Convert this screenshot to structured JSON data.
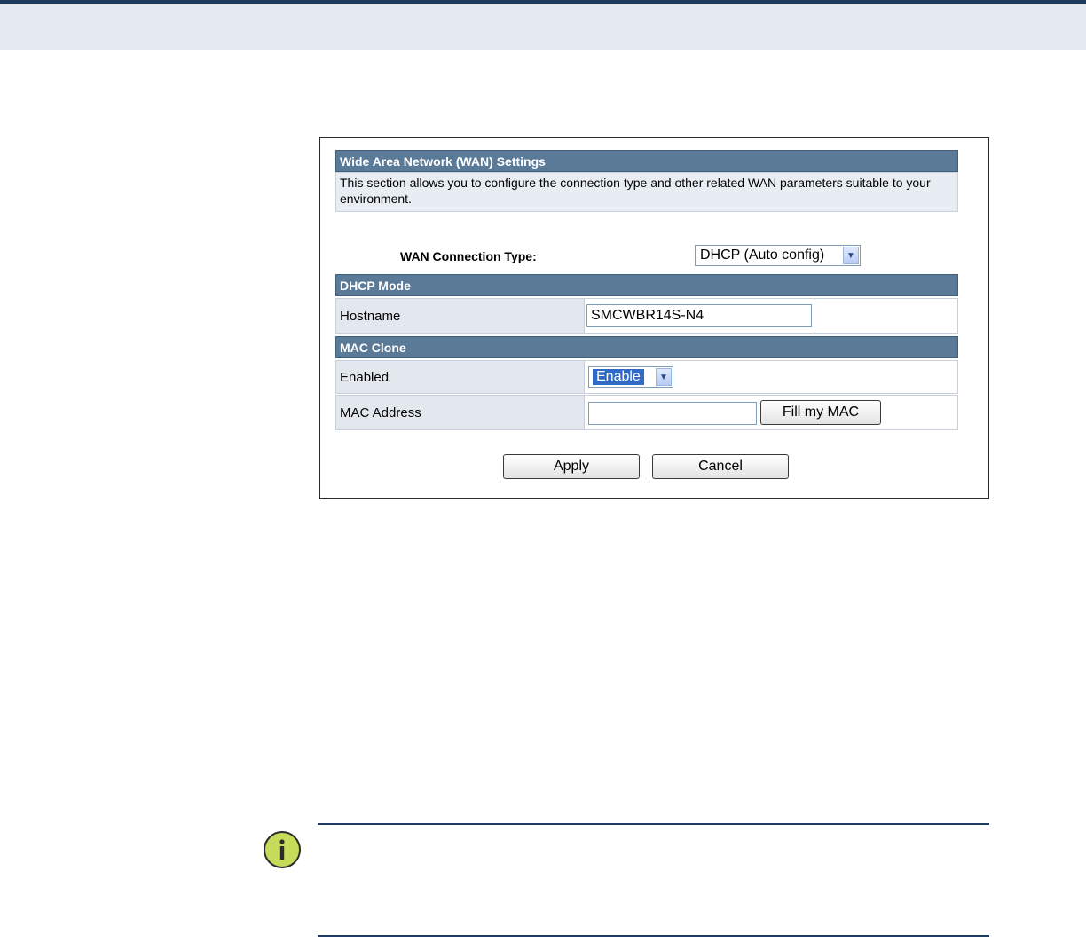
{
  "panel": {
    "title": "Wide Area Network (WAN) Settings",
    "description": "This section allows you to configure the connection type and other related WAN parameters suitable to your environment.",
    "wan_connection_type_label": "WAN Connection Type:",
    "wan_connection_type_value": "DHCP (Auto config)"
  },
  "dhcp": {
    "section_title": "DHCP Mode",
    "hostname_label": "Hostname",
    "hostname_value": "SMCWBR14S-N4"
  },
  "mac_clone": {
    "section_title": "MAC Clone",
    "enabled_label": "Enabled",
    "enabled_value": "Enable",
    "mac_address_label": "MAC Address",
    "mac_address_value": "",
    "fill_button": "Fill my MAC"
  },
  "actions": {
    "apply": "Apply",
    "cancel": "Cancel"
  },
  "colors": {
    "header_blue": "#5a7a98",
    "top_band": "#e5e9f1",
    "rule_navy": "#1f3a5f",
    "note_icon_green": "#c6db5a"
  },
  "icons": {
    "note": "info-icon",
    "dropdown": "chevron-down-icon"
  }
}
